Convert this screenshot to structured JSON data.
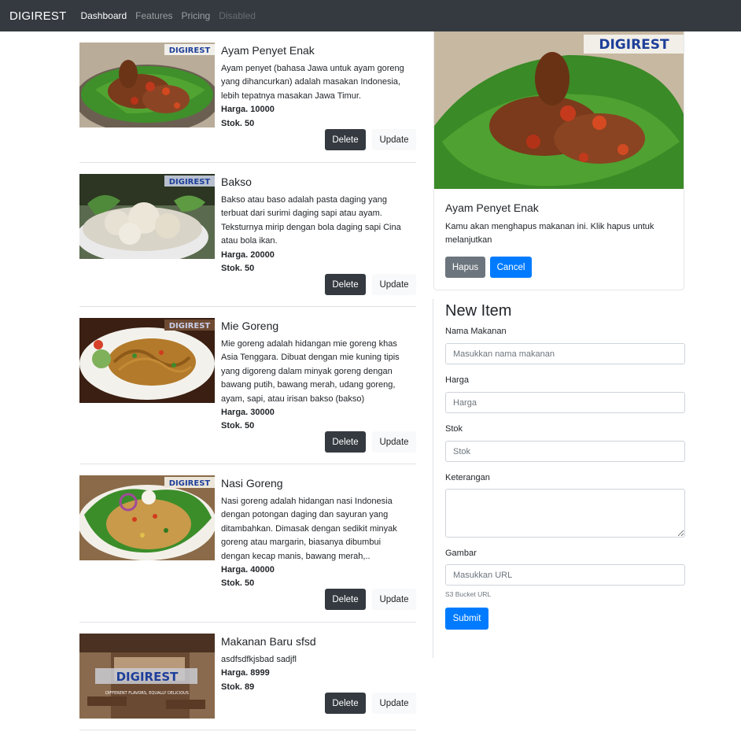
{
  "navbar": {
    "brand": "DIGIREST",
    "links": [
      {
        "label": "Dashboard",
        "state": "active"
      },
      {
        "label": "Features",
        "state": "normal"
      },
      {
        "label": "Pricing",
        "state": "normal"
      },
      {
        "label": "Disabled",
        "state": "disabled"
      }
    ]
  },
  "image_logo_text": "DIGIREST",
  "foods": [
    {
      "name": "Ayam Penyet Enak",
      "desc_lines": [
        "Ayam penyet (bahasa Jawa untuk ayam goreng",
        "yang dihancurkan) adalah masakan Indonesia,",
        "lebih tepatnya masakan Jawa Timur."
      ],
      "harga": "Harga. 10000",
      "stok": "Stok. 50",
      "delete_label": "Delete",
      "update_label": "Update",
      "image": "ayam-penyet"
    },
    {
      "name": "Bakso",
      "desc_lines": [
        "Bakso atau baso adalah pasta daging yang",
        "terbuat dari surimi daging sapi atau ayam.",
        "Teksturnya mirip dengan bola daging sapi Cina",
        "atau bola ikan."
      ],
      "harga": "Harga. 20000",
      "stok": "Stok. 50",
      "delete_label": "Delete",
      "update_label": "Update",
      "image": "bakso"
    },
    {
      "name": "Mie Goreng",
      "desc_lines": [
        "Mie goreng adalah hidangan mie goreng khas",
        "Asia Tenggara. Dibuat dengan mie kuning tipis",
        "yang digoreng dalam minyak goreng dengan",
        "bawang putih, bawang merah, udang goreng,",
        "ayam, sapi, atau irisan bakso (bakso)"
      ],
      "harga": "Harga. 30000",
      "stok": "Stok. 50",
      "delete_label": "Delete",
      "update_label": "Update",
      "image": "mie-goreng"
    },
    {
      "name": "Nasi Goreng",
      "desc_lines": [
        "Nasi goreng adalah hidangan nasi Indonesia",
        "dengan potongan daging dan sayuran yang",
        "ditambahkan. Dimasak dengan sedikit minyak",
        "goreng atau margarin, biasanya dibumbui",
        "dengan kecap manis, bawang merah,.."
      ],
      "harga": "Harga. 40000",
      "stok": "Stok. 50",
      "delete_label": "Delete",
      "update_label": "Update",
      "image": "nasi-goreng"
    },
    {
      "name": "Makanan Baru sfsd",
      "desc_lines": [
        "asdfsdfkjsbad sadjfl"
      ],
      "harga": "Harga. 8999",
      "stok": "Stok. 89",
      "delete_label": "Delete",
      "update_label": "Update",
      "image": "restaurant-logo",
      "image_tagline": "DIFFERENT FLAVORS, EQUALLY DELICIOUS"
    }
  ],
  "delete_card": {
    "title": "Ayam Penyet Enak",
    "text": "Kamu akan menghapus makanan ini. Klik hapus untuk melanjutkan",
    "hapus_label": "Hapus",
    "cancel_label": "Cancel"
  },
  "form": {
    "title": "New Item",
    "nama_label": "Nama Makanan",
    "nama_placeholder": "Masukkan nama makanan",
    "harga_label": "Harga",
    "harga_placeholder": "Harga",
    "stok_label": "Stok",
    "stok_placeholder": "Stok",
    "keterangan_label": "Keterangan",
    "gambar_label": "Gambar",
    "gambar_placeholder": "Masukkan URL",
    "gambar_help": "S3 Bucket URL",
    "submit_label": "Submit"
  },
  "colors": {
    "navbar_bg": "#343a40",
    "primary": "#007bff",
    "secondary": "#6c757d",
    "dark": "#343a40",
    "light": "#f8f9fa"
  }
}
